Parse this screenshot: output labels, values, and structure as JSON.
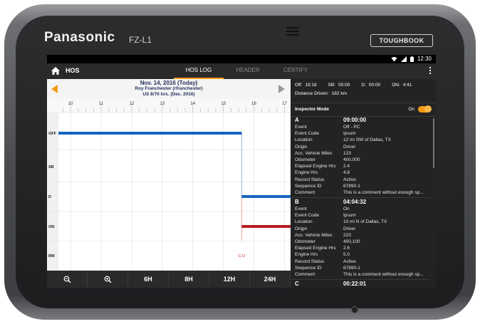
{
  "device": {
    "brand": "Panasonic",
    "model": "FZ-L1",
    "badge": "TOUGHBOOK"
  },
  "status": {
    "time": "12:30"
  },
  "appbar": {
    "title": "HOS",
    "tabs": [
      {
        "label": "HOS LOG"
      },
      {
        "label": "HEADER"
      },
      {
        "label": "CERTIFY"
      }
    ]
  },
  "log_header": {
    "date": "Nov. 14, 2016 (Today)",
    "driver": "Roy Franchester (rfranchester)",
    "cycle": "US 8/70 hrs. (Dec. 2016)"
  },
  "chart_data": {
    "type": "line",
    "hours": [
      "10",
      "11",
      "12",
      "13",
      "14",
      "15",
      "16",
      "17"
    ],
    "statuses": [
      "OFF",
      "SB",
      "D",
      "ON",
      "RM"
    ],
    "segments": [
      {
        "status": "OFF",
        "start": 9.6,
        "end": 15.6,
        "color": "#1565c0"
      },
      {
        "status": "D",
        "start": 15.6,
        "end": 17.2,
        "color": "#1565c0"
      },
      {
        "status": "ON",
        "start": 15.6,
        "end": 17.2,
        "color": "#b71c1c"
      }
    ],
    "transition_hour": 15.6,
    "annotation": "C-O",
    "x_range": [
      9.6,
      17.2
    ]
  },
  "bottom": {
    "buttons": [
      "6H",
      "8H",
      "12H",
      "24H"
    ]
  },
  "summary": {
    "off_label": "Off:",
    "off": "19:18",
    "sb_label": "SB:",
    "sb": "00:00",
    "d_label": "D:",
    "d": "00:00",
    "on_label": "ON:",
    "on": "4:41",
    "distance_label": "Distance Driven:",
    "distance": "182 km"
  },
  "inspector": {
    "label": "Inspector Mode",
    "value": "On"
  },
  "entries": [
    {
      "letter": "A",
      "time": "09:00:00",
      "rows": [
        {
          "k": "Event",
          "v": "Off - PC"
        },
        {
          "k": "Event Code",
          "v": "Ipsum"
        },
        {
          "k": "Location",
          "v": "12 mi SW of Dallas, TX"
        },
        {
          "k": "Origin",
          "v": "Driver"
        },
        {
          "k": "Acc. Vehicle Miles",
          "v": "123"
        },
        {
          "k": "Odometer",
          "v": "400,000"
        },
        {
          "k": "Elapsed Engine Hrs",
          "v": "2.4"
        },
        {
          "k": "Engine Hrs",
          "v": "4.8"
        },
        {
          "k": "Record Status",
          "v": "Active"
        },
        {
          "k": "Sequence ID",
          "v": "67890-1"
        },
        {
          "k": "Comment",
          "v": "This is a comment without enough sp..."
        }
      ]
    },
    {
      "letter": "B",
      "time": "04:04:32",
      "rows": [
        {
          "k": "Event",
          "v": "On"
        },
        {
          "k": "Event Code",
          "v": "Ipsum"
        },
        {
          "k": "Location",
          "v": "10 mi N of Dallas, TX"
        },
        {
          "k": "Origin",
          "v": "Driver"
        },
        {
          "k": "Acc. Vehicle Miles",
          "v": "223"
        },
        {
          "k": "Odometer",
          "v": "400,100"
        },
        {
          "k": "Elapsed Engine Hrs",
          "v": "2.6"
        },
        {
          "k": "Engine Hrs",
          "v": "5.0"
        },
        {
          "k": "Record Status",
          "v": "Active"
        },
        {
          "k": "Sequence ID",
          "v": "67890-1"
        },
        {
          "k": "Comment",
          "v": "This is a comment without enough sp..."
        }
      ]
    },
    {
      "letter": "C",
      "time": "00:22:01",
      "rows": []
    }
  ]
}
